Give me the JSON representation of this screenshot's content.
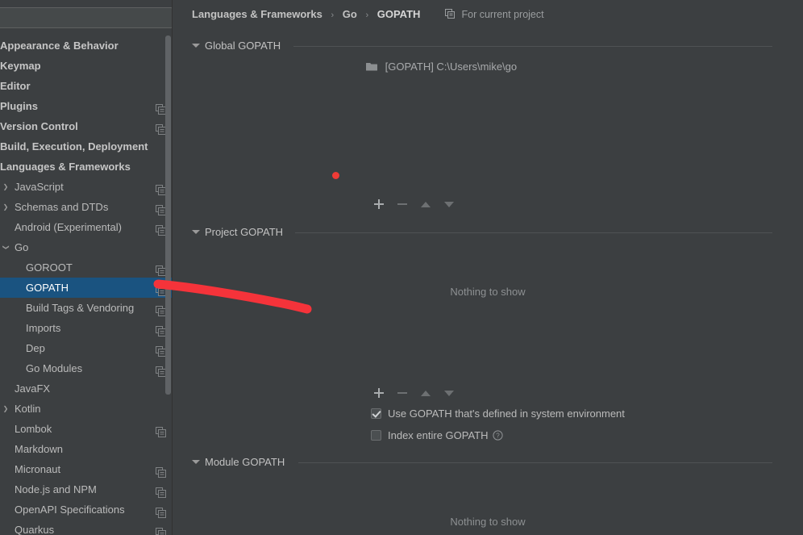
{
  "window": {
    "theme_bg": "#3c3f41",
    "accent_selection": "#1a5380",
    "annotation_color": "#f5333a"
  },
  "sidebar": {
    "search": {
      "value": "",
      "placeholder": ""
    },
    "items": [
      {
        "label": "Appearance & Behavior",
        "level": 0,
        "bold": true,
        "arrow": "none",
        "copy": false,
        "selected": false
      },
      {
        "label": "Keymap",
        "level": 0,
        "bold": true,
        "arrow": "none",
        "copy": false,
        "selected": false
      },
      {
        "label": "Editor",
        "level": 0,
        "bold": true,
        "arrow": "none",
        "copy": false,
        "selected": false
      },
      {
        "label": "Plugins",
        "level": 0,
        "bold": true,
        "arrow": "none",
        "copy": true,
        "selected": false
      },
      {
        "label": "Version Control",
        "level": 0,
        "bold": true,
        "arrow": "none",
        "copy": true,
        "selected": false
      },
      {
        "label": "Build, Execution, Deployment",
        "level": 0,
        "bold": true,
        "arrow": "none",
        "copy": false,
        "selected": false
      },
      {
        "label": "Languages & Frameworks",
        "level": 0,
        "bold": true,
        "arrow": "none",
        "copy": false,
        "selected": false
      },
      {
        "label": "JavaScript",
        "level": 1,
        "bold": false,
        "arrow": "closed",
        "copy": true,
        "selected": false
      },
      {
        "label": "Schemas and DTDs",
        "level": 1,
        "bold": false,
        "arrow": "closed",
        "copy": true,
        "selected": false
      },
      {
        "label": "Android (Experimental)",
        "level": 1,
        "bold": false,
        "arrow": "none",
        "copy": true,
        "selected": false
      },
      {
        "label": "Go",
        "level": 1,
        "bold": false,
        "arrow": "open",
        "copy": false,
        "selected": false
      },
      {
        "label": "GOROOT",
        "level": 2,
        "bold": false,
        "arrow": "none",
        "copy": true,
        "selected": false
      },
      {
        "label": "GOPATH",
        "level": 2,
        "bold": false,
        "arrow": "none",
        "copy": true,
        "selected": true
      },
      {
        "label": "Build Tags & Vendoring",
        "level": 2,
        "bold": false,
        "arrow": "none",
        "copy": true,
        "selected": false
      },
      {
        "label": "Imports",
        "level": 2,
        "bold": false,
        "arrow": "none",
        "copy": true,
        "selected": false
      },
      {
        "label": "Dep",
        "level": 2,
        "bold": false,
        "arrow": "none",
        "copy": true,
        "selected": false
      },
      {
        "label": "Go Modules",
        "level": 2,
        "bold": false,
        "arrow": "none",
        "copy": true,
        "selected": false
      },
      {
        "label": "JavaFX",
        "level": 1,
        "bold": false,
        "arrow": "none",
        "copy": false,
        "selected": false
      },
      {
        "label": "Kotlin",
        "level": 1,
        "bold": false,
        "arrow": "closed",
        "copy": false,
        "selected": false
      },
      {
        "label": "Lombok",
        "level": 1,
        "bold": false,
        "arrow": "none",
        "copy": true,
        "selected": false
      },
      {
        "label": "Markdown",
        "level": 1,
        "bold": false,
        "arrow": "none",
        "copy": false,
        "selected": false
      },
      {
        "label": "Micronaut",
        "level": 1,
        "bold": false,
        "arrow": "none",
        "copy": true,
        "selected": false
      },
      {
        "label": "Node.js and NPM",
        "level": 1,
        "bold": false,
        "arrow": "none",
        "copy": true,
        "selected": false
      },
      {
        "label": "OpenAPI Specifications",
        "level": 1,
        "bold": false,
        "arrow": "none",
        "copy": true,
        "selected": false
      },
      {
        "label": "Quarkus",
        "level": 1,
        "bold": false,
        "arrow": "none",
        "copy": true,
        "selected": false
      }
    ]
  },
  "panel": {
    "breadcrumb": {
      "crumb1": "Languages & Frameworks",
      "crumb2": "Go",
      "crumb3": "GOPATH",
      "separator": "›"
    },
    "scope_badge": {
      "label": "For current project",
      "icon": "copy-scope-icon"
    },
    "global_section": {
      "title": "Global GOPATH",
      "entry": "[GOPATH] C:\\Users\\mike\\go"
    },
    "project_section": {
      "title": "Project GOPATH",
      "empty_text": "Nothing to show"
    },
    "module_section": {
      "title": "Module GOPATH",
      "empty_text": "Nothing to show"
    },
    "toolbar": {
      "add_label": "+",
      "remove_label": "−",
      "move_up_label": "▲",
      "move_down_label": "▼"
    },
    "options": {
      "use_system_gopath": {
        "label": "Use GOPATH that's defined in system environment",
        "checked": true
      },
      "index_entire_gopath": {
        "label": "Index entire GOPATH",
        "checked": false,
        "help": "?"
      }
    }
  }
}
